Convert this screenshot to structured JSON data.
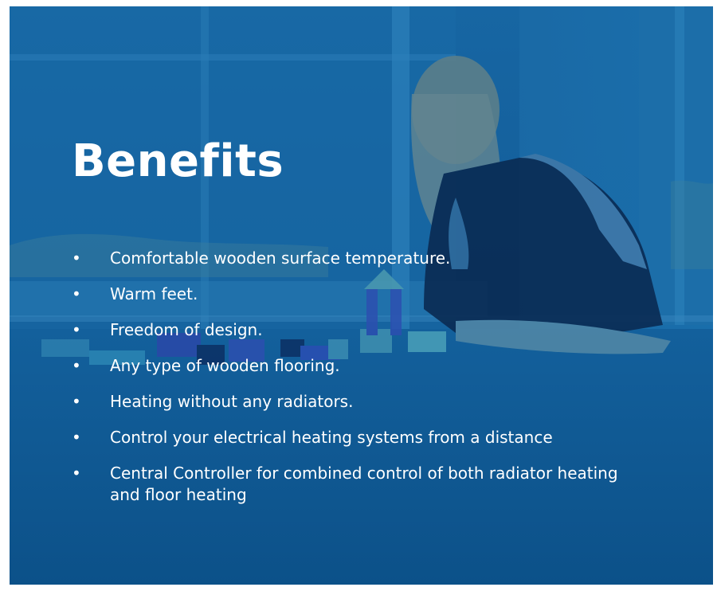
{
  "title": "Benefits",
  "benefits": [
    "Comfortable wooden surface temperature.",
    "Warm feet.",
    "Freedom of design.",
    "Any type of wooden flooring.",
    "Heating without any radiators.",
    "Control your electrical heating systems from a distance",
    "Central Controller for combined control of both radiator heating and floor heating"
  ],
  "colors": {
    "overlay": "#0f5a94",
    "text": "#ffffff"
  }
}
